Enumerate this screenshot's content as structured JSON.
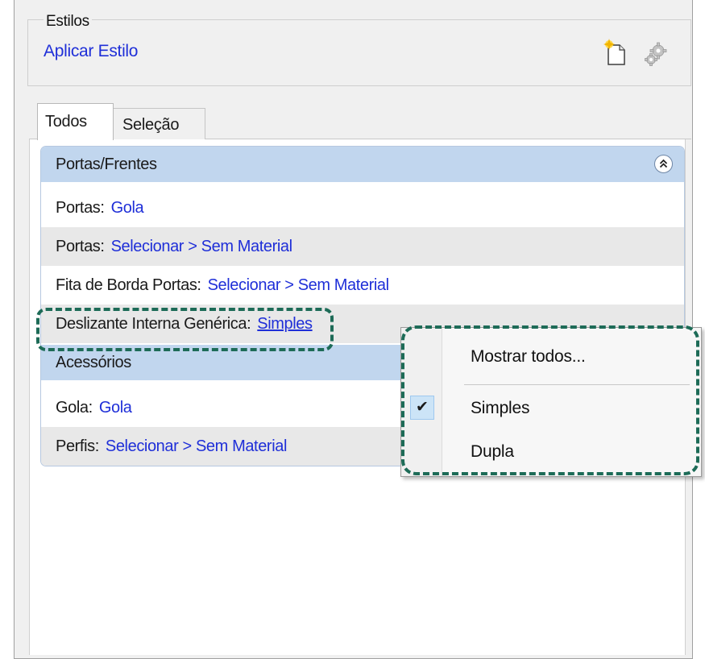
{
  "styles": {
    "caption": "Estilos",
    "apply_link": "Aplicar Estilo",
    "new_icon": "new-document-icon",
    "settings_icon": "gear-icon"
  },
  "tabs": [
    {
      "label": "Todos",
      "selected": true
    },
    {
      "label": "Seleção",
      "selected": false
    }
  ],
  "sections": [
    {
      "header": "Portas/Frentes",
      "collapse_icon": "double-chevron-up-icon",
      "rows": [
        {
          "label": "Portas:",
          "value": "Gola"
        },
        {
          "label": "Portas:",
          "value": "Selecionar > Sem Material"
        },
        {
          "label": "Fita de Borda Portas:",
          "value": "Selecionar > Sem Material"
        },
        {
          "label": "Deslizante Interna Genérica:",
          "value": "Simples"
        }
      ]
    },
    {
      "header": "Acessórios",
      "rows": [
        {
          "label": "Gola:",
          "value": "Gola"
        },
        {
          "label": "Perfis:",
          "value": "Selecionar > Sem Material"
        }
      ]
    }
  ],
  "context_menu": {
    "show_all": "Mostrar todos...",
    "options": [
      {
        "label": "Simples",
        "checked": true
      },
      {
        "label": "Dupla",
        "checked": false
      }
    ],
    "check_icon": "checkmark-icon"
  },
  "colors": {
    "link": "#1f2fd8",
    "section_header": "#c1d6ee",
    "alt_row": "#e8e8e8",
    "highlight": "#1d6b57"
  }
}
